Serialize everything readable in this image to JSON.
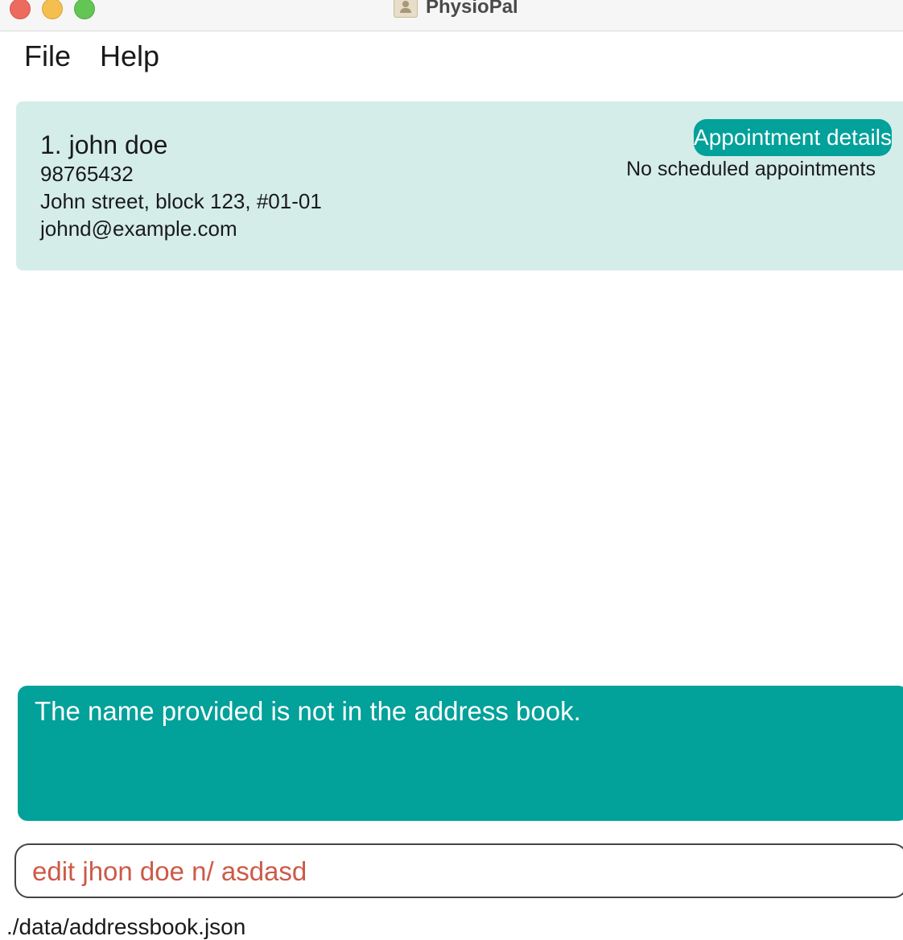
{
  "window": {
    "title": "PhysioPal",
    "app_icon": "contacts-book-icon"
  },
  "menu": {
    "items": [
      {
        "label": "File"
      },
      {
        "label": "Help"
      }
    ]
  },
  "person_list": [
    {
      "index_name": "1. john doe",
      "phone": "98765432",
      "address": "John street, block 123, #01-01",
      "email": "johnd@example.com",
      "appointment_button_label": "Appointment details",
      "appointment_status": "No scheduled appointments"
    }
  ],
  "result_display": {
    "message": "The name provided is not in the address book."
  },
  "command_box": {
    "value": "edit jhon doe n/ asdasd"
  },
  "status_bar": {
    "path": "./data/addressbook.json"
  },
  "colors": {
    "accent": "#02a19a",
    "card_background": "#d4ede9",
    "error_text": "#cd5a47"
  }
}
